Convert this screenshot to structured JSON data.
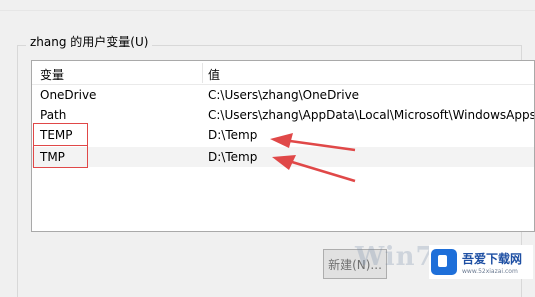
{
  "group": {
    "title": "zhang 的用户变量(U)"
  },
  "list": {
    "headers": [
      "变量",
      "值"
    ],
    "rows": [
      {
        "name": "OneDrive",
        "value": "C:\\Users\\zhang\\OneDrive"
      },
      {
        "name": "Path",
        "value": "C:\\Users\\zhang\\AppData\\Local\\Microsoft\\WindowsApps;"
      },
      {
        "name": "TEMP",
        "value": "D:\\Temp"
      },
      {
        "name": "TMP",
        "value": "D:\\Temp"
      }
    ]
  },
  "buttons": {
    "new_label": "新建(N)..."
  },
  "watermark": {
    "text": "Win7"
  },
  "brand": {
    "name": "吾爱下载网",
    "url": "www.52xiazai.com"
  },
  "colors": {
    "annotation": "#e04848",
    "selected_row": "#f3f3f3",
    "brand_blue": "#1e6fd9"
  }
}
